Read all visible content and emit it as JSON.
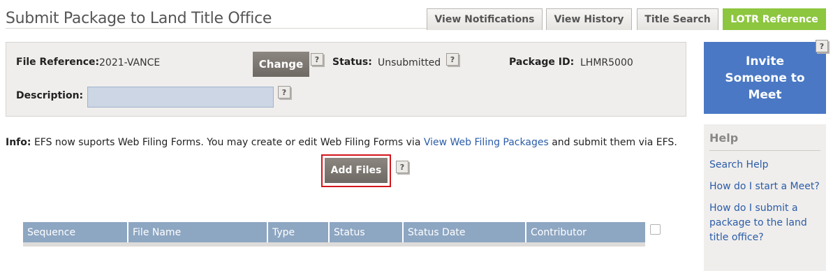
{
  "page": {
    "title": "Submit Package to Land Title Office"
  },
  "tabs": [
    {
      "label": "View Notifications"
    },
    {
      "label": "View History"
    },
    {
      "label": "Title Search"
    },
    {
      "label": "LOTR Reference"
    }
  ],
  "file_info": {
    "file_reference_label": "File Reference:",
    "file_reference_value": "2021-VANCE",
    "change_label": "Change",
    "status_label": "Status:",
    "status_value": "Unsubmitted",
    "package_id_label": "Package ID:",
    "package_id_value": "LHMR5000",
    "description_label": "Description:",
    "description_value": ""
  },
  "help_icon_text": "?",
  "invite": {
    "label": "Invite Someone to Meet"
  },
  "help": {
    "title": "Help",
    "links": [
      "Search Help",
      "How do I start a Meet?",
      "How do I submit a package to the land title office?"
    ]
  },
  "info": {
    "prefix": "Info:",
    "text_before": "EFS now suports Web Filing Forms. You may create or edit Web Filing Forms via",
    "link": "View Web Filing Packages",
    "text_after": "and submit them via EFS."
  },
  "add_files": {
    "label": "Add Files"
  },
  "table": {
    "columns": [
      "Sequence",
      "File Name",
      "Type",
      "Status",
      "Status Date",
      "Contributor"
    ]
  },
  "colors": {
    "active_tab": "#8dc63f",
    "invite_button": "#4a78c4",
    "table_header": "#8da6c2",
    "link": "#2a5ca8",
    "highlight_outline": "#d2151c"
  }
}
